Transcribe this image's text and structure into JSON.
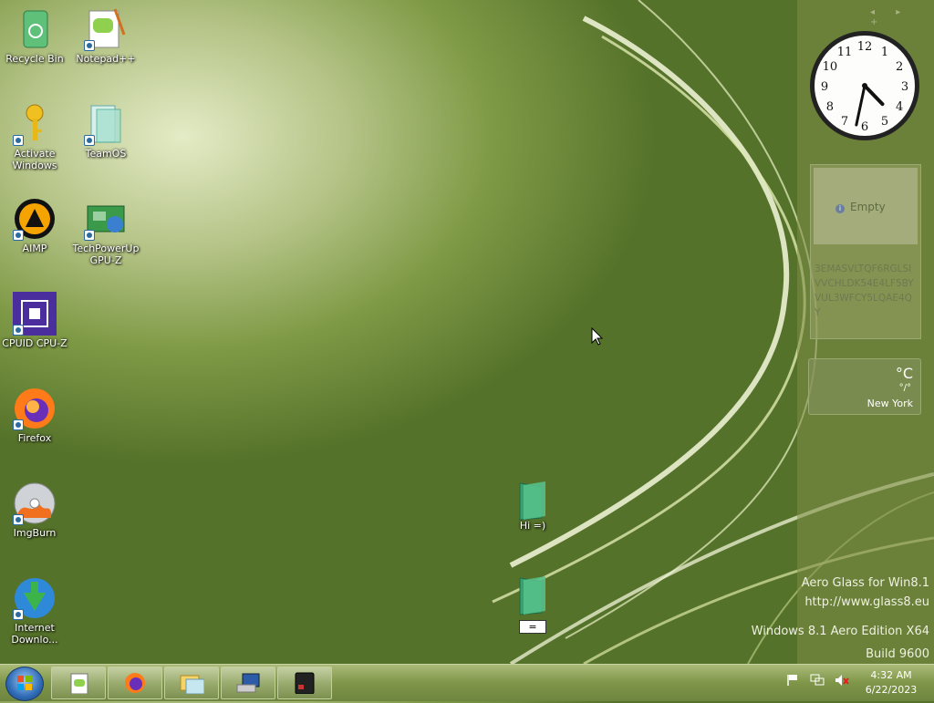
{
  "desktop": {
    "icons": [
      {
        "label": "Recycle Bin",
        "icon": "recycle-bin-icon"
      },
      {
        "label": "Notepad++",
        "icon": "notepad-plus-plus-icon"
      },
      {
        "label": "Activate Windows",
        "icon": "key-icon"
      },
      {
        "label": "TeamOS",
        "icon": "teamos-icon"
      },
      {
        "label": "AIMP",
        "icon": "aimp-icon"
      },
      {
        "label": "TechPowerUp GPU-Z",
        "icon": "gpu-z-icon"
      },
      {
        "label": "CPUID CPU-Z",
        "icon": "cpu-z-icon"
      },
      {
        "label": "Firefox",
        "icon": "firefox-icon"
      },
      {
        "label": "ImgBurn",
        "icon": "imgburn-icon"
      },
      {
        "label": "Internet Downlo...",
        "icon": "internet-download-manager-icon"
      }
    ],
    "folders": [
      {
        "label": "Hi =)",
        "icon": "folder-icon"
      },
      {
        "label": "=",
        "icon": "folder-icon"
      }
    ]
  },
  "sidebar": {
    "nav": "◂ ▸ +",
    "notes": {
      "empty_label": "Empty",
      "text": "3EMASVLTQF6RGLSIVVCHLDK54E4LF5BYVUL3WFCY5LQAE4QY"
    },
    "weather": {
      "temp": "°C",
      "range": "°/°",
      "city": "New York"
    },
    "clock": {
      "hour": 4,
      "minute": 32
    }
  },
  "watermark": {
    "line1": "Aero Glass for Win8.1",
    "line2": "http://www.glass8.eu",
    "line3": "Windows 8.1 Aero Edition X64",
    "line4": "Build 9600"
  },
  "taskbar": {
    "pinned": [
      {
        "icon": "notepad-plus-plus-icon"
      },
      {
        "icon": "firefox-icon"
      },
      {
        "icon": "file-explorer-icon"
      },
      {
        "icon": "computer-network-icon"
      },
      {
        "icon": "terminal-icon"
      }
    ],
    "time": "4:32 AM",
    "date": "6/22/2023"
  },
  "colors": {
    "accent": "#7f9a46",
    "taskbar": "#7f9548"
  }
}
